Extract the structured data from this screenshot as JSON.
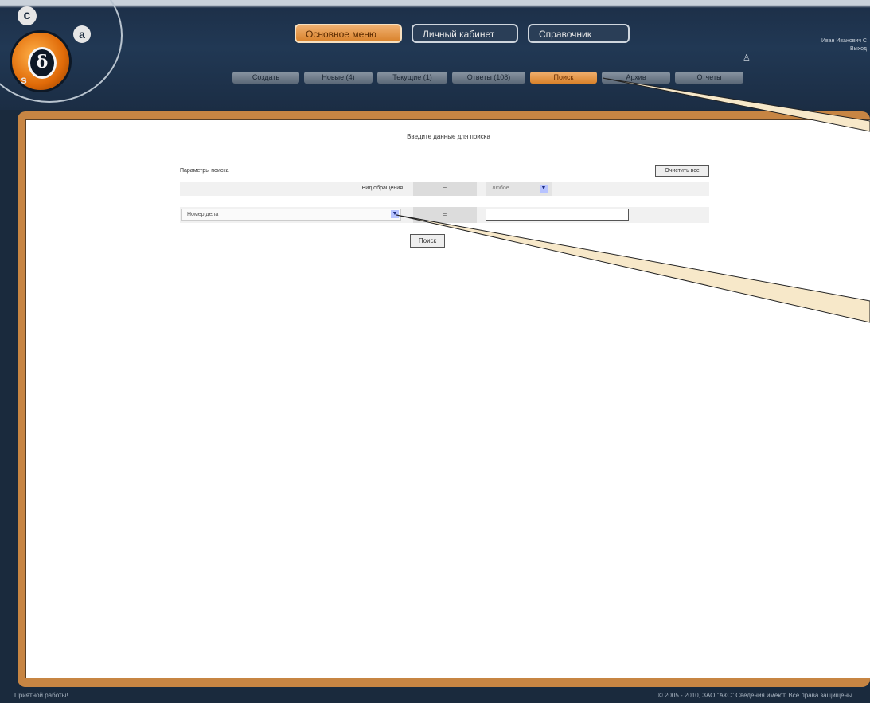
{
  "header": {
    "top_tabs": [
      {
        "label": "Основное меню",
        "active": true
      },
      {
        "label": "Личный кабинет",
        "active": false
      },
      {
        "label": "Справочник",
        "active": false
      }
    ],
    "sub_tabs": [
      {
        "label": "Создать",
        "active": false
      },
      {
        "label": "Новые (4)",
        "active": false
      },
      {
        "label": "Текущие (1)",
        "active": false
      },
      {
        "label": "Ответы (108)",
        "active": false
      },
      {
        "label": "Поиск",
        "active": true
      },
      {
        "label": "Архив",
        "active": false
      },
      {
        "label": "Отчеты",
        "active": false
      }
    ],
    "user_line1": "Иван Иванович С",
    "user_line2": "Выход"
  },
  "panel": {
    "title": "Введите данные для поиска",
    "search_params_label": "Параметры поиска",
    "clear_all_label": "Очистить все",
    "row1": {
      "label": "Вид обращения",
      "operator": "=",
      "value": "Любое"
    },
    "row2": {
      "field": "Номер дела",
      "operator": "=",
      "value": ""
    },
    "search_button": "Поиск"
  },
  "footer": {
    "left": "Приятной работы!",
    "right": "© 2005 - 2010, ЗАО \"АКС\" Сведения имеют. Все права защищены."
  },
  "colors": {
    "accent": "#d9822b",
    "frame": "#c78543",
    "header_bg": "#1d3049"
  }
}
